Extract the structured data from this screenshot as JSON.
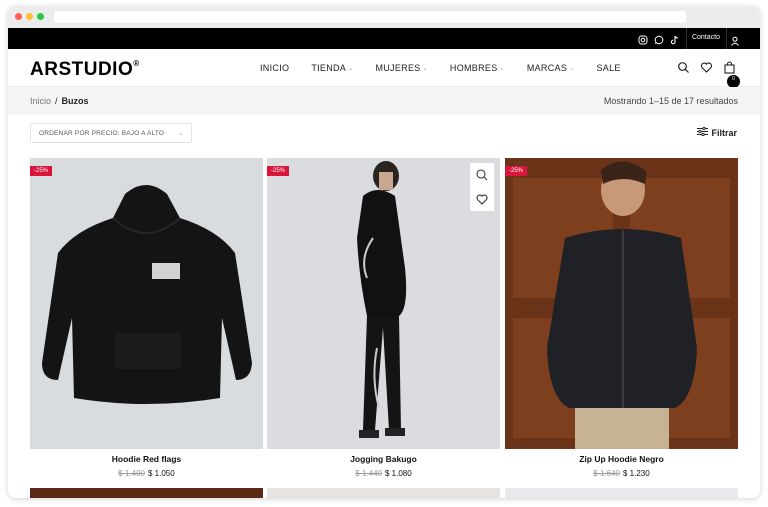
{
  "topbar": {
    "contact": "Contacto",
    "social_icons": [
      "instagram-icon",
      "whatsapp-icon",
      "tiktok-icon"
    ]
  },
  "header": {
    "logo": "ARSTUDIO",
    "logo_mark": "®",
    "nav": [
      {
        "label": "INICIO",
        "has_dropdown": false
      },
      {
        "label": "TIENDA",
        "has_dropdown": true
      },
      {
        "label": "MUJERES",
        "has_dropdown": true
      },
      {
        "label": "HOMBRES",
        "has_dropdown": true
      },
      {
        "label": "MARCAS",
        "has_dropdown": true
      },
      {
        "label": "SALE",
        "has_dropdown": false
      }
    ],
    "cart_count": "0"
  },
  "breadcrumb": {
    "home": "Inicio",
    "separator": "/",
    "current": "Buzos"
  },
  "results_text": "Mostrando 1–15 de 17 resultados",
  "sort": {
    "label": "ORDENAR POR PRECIO: BAJO A ALTO"
  },
  "filter": {
    "label": "Filtrar"
  },
  "products": [
    {
      "name": "Hoodie Red flags",
      "old_price": "$ 1.400",
      "price": "$ 1.050",
      "discount": "-25%",
      "bg": "#d9dcdf"
    },
    {
      "name": "Jogging Bakugo",
      "old_price": "$ 1.440",
      "price": "$ 1.080",
      "discount": "-25%",
      "bg": "#dadcdf"
    },
    {
      "name": "Zip Up Hoodie Negro",
      "old_price": "$ 1.640",
      "price": "$ 1.230",
      "discount": "-25%",
      "bg": "#7a3d1f"
    }
  ],
  "colors": {
    "accent": "#d8153a",
    "topbar": "#000000"
  }
}
